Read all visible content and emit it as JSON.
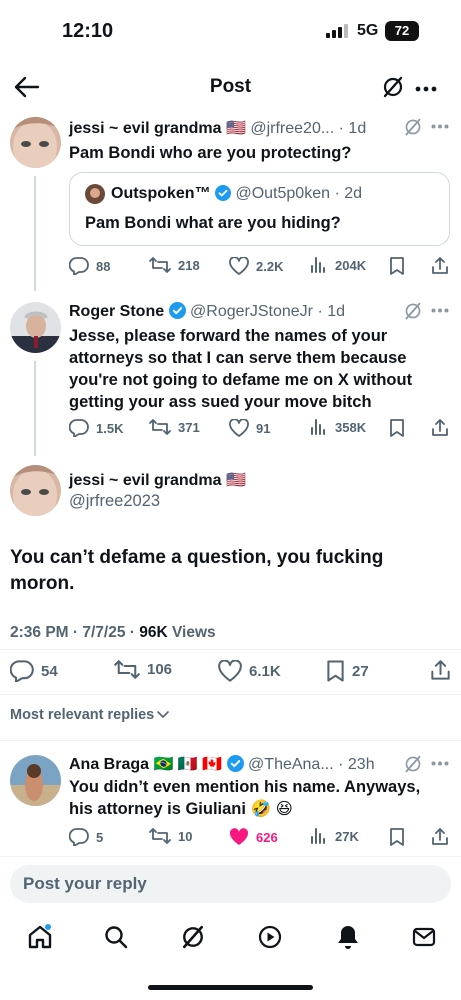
{
  "status_bar": {
    "time": "12:10",
    "network": "5G",
    "battery": "72"
  },
  "header": {
    "title": "Post"
  },
  "tweet1": {
    "name": "jessi ~ evil grandma",
    "flag": "🇺🇸",
    "handle": "@jrfree20...",
    "time": "· 1d",
    "text": "Pam Bondi who are you protecting?",
    "quote": {
      "name": "Outspoken™",
      "handle": "@Out5p0ken",
      "time": "· 2d",
      "text": "Pam Bondi what are you hiding?"
    },
    "stats": {
      "replies": "88",
      "reposts": "218",
      "likes": "2.2K",
      "views": "204K"
    }
  },
  "tweet2": {
    "name": "Roger Stone",
    "handle": "@RogerJStoneJr",
    "time": "· 1d",
    "text": "Jesse, please forward the names of your attorneys so that I can serve them because you're not going to defame me on X without getting your ass sued your move bitch",
    "stats": {
      "replies": "1.5K",
      "reposts": "371",
      "likes": "91",
      "views": "358K"
    }
  },
  "main_tweet": {
    "name": "jessi ~ evil grandma",
    "flag": "🇺🇸",
    "handle": "@jrfree2023",
    "text": "You can’t defame a question, you fucking moron.",
    "time": "2:36 PM · 7/7/25 · ",
    "views_count": "96K",
    "views_label": " Views",
    "stats": {
      "replies": "54",
      "reposts": "106",
      "likes": "6.1K",
      "bookmarks": "27"
    }
  },
  "replies_filter": "Most relevant replies",
  "reply1": {
    "name": "Ana Braga",
    "flags": "🇧🇷 🇲🇽 🇨🇦",
    "handle": "@TheAna...",
    "time": "· 23h",
    "text": "You didn’t even mention his name. Anyways, his attorney is Giuliani 🤣 😆",
    "stats": {
      "replies": "5",
      "reposts": "10",
      "likes": "626",
      "views": "27K"
    }
  },
  "reply_bar": {
    "placeholder": "Post your reply"
  },
  "colors": {
    "verified": "#1d9bf0",
    "like_active": "#f91880",
    "text": "#0f1419",
    "secondary": "#536471"
  },
  "icons": [
    "back-arrow-icon",
    "grok-icon",
    "more-icon",
    "reply-icon",
    "repost-icon",
    "like-icon",
    "views-icon",
    "bookmark-icon",
    "share-icon",
    "home-icon",
    "search-icon",
    "video-icon",
    "notifications-icon",
    "messages-icon"
  ]
}
